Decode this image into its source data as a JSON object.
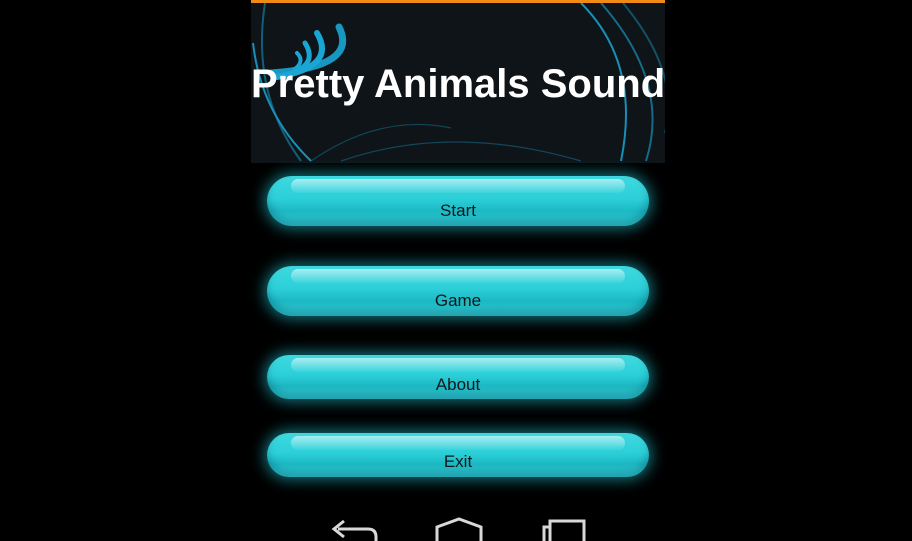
{
  "app": {
    "title": "Pretty Animals Sound",
    "colors": {
      "accent": "#2ccfd8",
      "header_background": "#0f1418",
      "status_strip": "#f08a17",
      "background": "#000000"
    },
    "header_icon": "sound-waves-icon"
  },
  "menu": {
    "start_label": "Start",
    "game_label": "Game",
    "about_label": "About",
    "exit_label": "Exit"
  },
  "navbar": {
    "back_icon": "back-icon",
    "home_icon": "home-icon",
    "recents_icon": "recent-apps-icon"
  }
}
